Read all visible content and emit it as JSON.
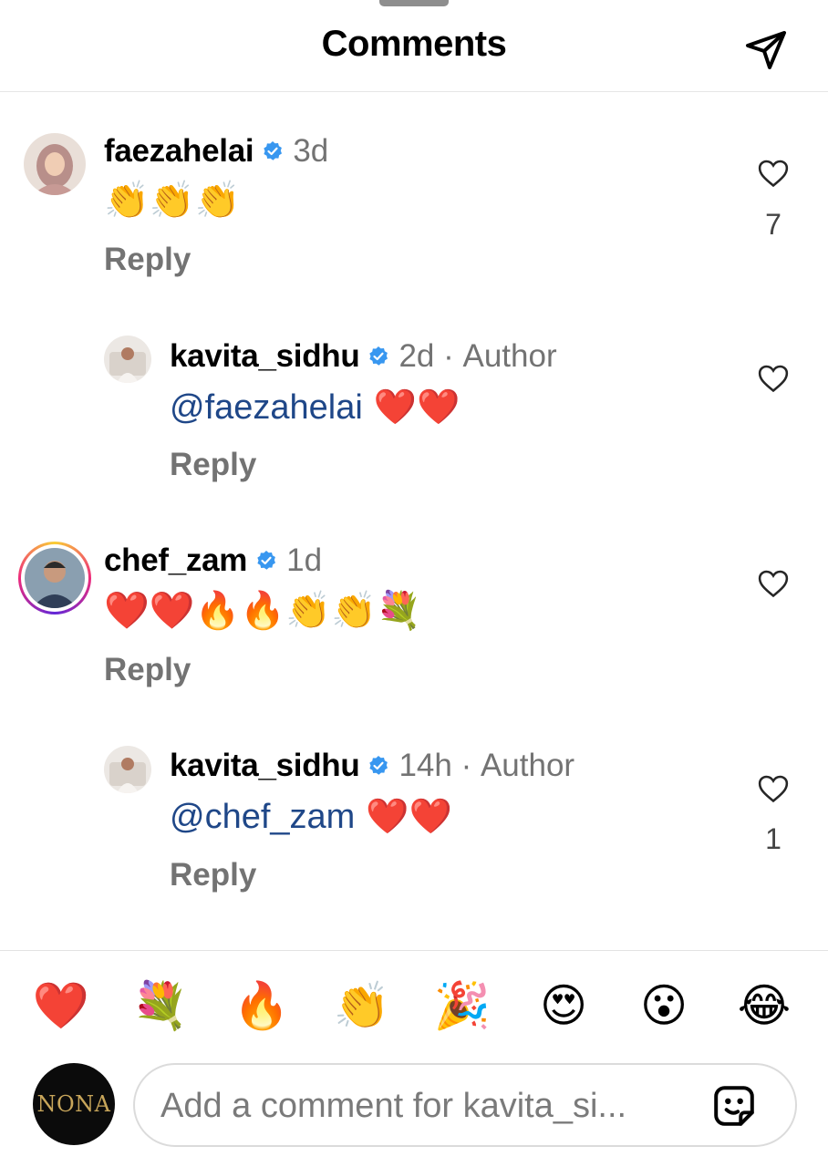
{
  "header": {
    "title": "Comments"
  },
  "comments": [
    {
      "username": "faezahelai",
      "verified": true,
      "time": "3d",
      "author_label": "",
      "text": "👏👏👏",
      "mention": "",
      "reply_label": "Reply",
      "likes": "7"
    },
    {
      "username": "kavita_sidhu",
      "verified": true,
      "time": "2d",
      "author_label": "Author",
      "mention": "@faezahelai",
      "text": " ❤️❤️",
      "reply_label": "Reply",
      "likes": ""
    },
    {
      "username": "chef_zam",
      "verified": true,
      "time": "1d",
      "author_label": "",
      "text": "❤️❤️🔥🔥👏👏💐",
      "mention": "",
      "reply_label": "Reply",
      "likes": ""
    },
    {
      "username": "kavita_sidhu",
      "verified": true,
      "time": "14h",
      "author_label": "Author",
      "mention": "@chef_zam",
      "text": " ❤️❤️",
      "reply_label": "Reply",
      "likes": "1"
    }
  ],
  "quick_reactions": [
    "❤️",
    "💐",
    "🔥",
    "👏",
    "🎉",
    "😍",
    "😮",
    "😂"
  ],
  "composer": {
    "avatar_text": "NONA",
    "placeholder": "Add a comment for kavita_si..."
  },
  "colors": {
    "verified": "#3897f0",
    "mention": "#1f4788",
    "muted": "#737373"
  },
  "icons": [
    "share-icon",
    "verified-icon",
    "heart-icon",
    "sticker-icon"
  ]
}
